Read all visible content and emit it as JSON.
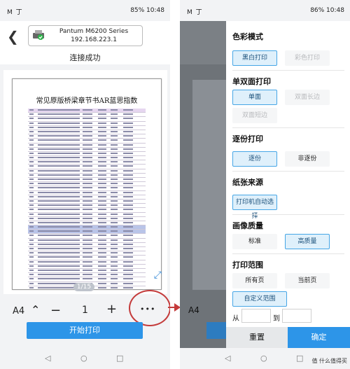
{
  "left": {
    "status": {
      "time_left": "M 丁",
      "right": "85% 10:48"
    },
    "printer": {
      "name": "Pantum M6200 Series",
      "ip": "192.168.223.1"
    },
    "connection_status": "连接成功",
    "document_title": "常见原版桥梁章节书AR蓝思指数",
    "page_indicator": "1/15",
    "paper_size": "A4",
    "copies": "1",
    "minus": "−",
    "plus": "+",
    "more": "•••",
    "print_button": "开始打印"
  },
  "right": {
    "status": {
      "right": "86% 10:48"
    },
    "behind": {
      "paper_size": "A4"
    },
    "sections": {
      "color": {
        "title": "色彩模式",
        "opt1": "黑白打印",
        "opt2": "彩色打印"
      },
      "duplex": {
        "title": "单双面打印",
        "opt1": "单面",
        "opt2": "双面长边",
        "opt3": "双面短边"
      },
      "collate": {
        "title": "逐份打印",
        "opt1": "逐份",
        "opt2": "非逐份"
      },
      "source": {
        "title": "纸张来源",
        "opt1": "打印机自动选择"
      },
      "quality": {
        "title": "画像质量",
        "opt1": "标准",
        "opt2": "高质量"
      },
      "range": {
        "title": "打印范围",
        "opt1": "所有页",
        "opt2": "当前页",
        "opt3": "自定义范围",
        "from": "从",
        "to": "到"
      }
    },
    "reset": "重置",
    "confirm": "确定",
    "watermark": "值 什么值得买"
  },
  "colors": {
    "accent": "#2d95e8",
    "highlight": "#c43b3b"
  },
  "icons": [
    "back-arrow-icon",
    "printer-icon",
    "check-badge-icon",
    "expand-icon",
    "chevron-up-icon",
    "nav-back-icon",
    "nav-home-icon",
    "nav-recent-icon"
  ]
}
